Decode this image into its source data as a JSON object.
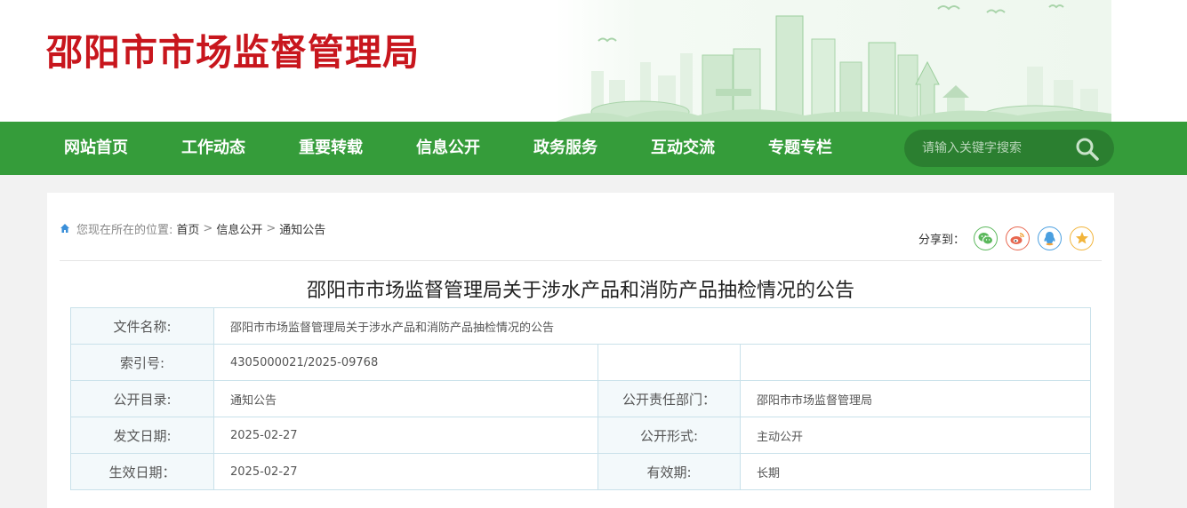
{
  "site": {
    "title": "邵阳市市场监督管理局"
  },
  "nav": {
    "items": [
      "网站首页",
      "工作动态",
      "重要转载",
      "信息公开",
      "政务服务",
      "互动交流",
      "专题专栏"
    ],
    "search_placeholder": "请输入关键字搜索"
  },
  "breadcrumb": {
    "prefix": "您现在所在的位置:",
    "items": [
      "首页",
      "信息公开",
      "通知公告"
    ],
    "separator": ">"
  },
  "share": {
    "label": "分享到：",
    "targets": [
      "wechat",
      "weibo",
      "qq",
      "qzone"
    ]
  },
  "article": {
    "title": "邵阳市市场监督管理局关于涉水产品和消防产品抽检情况的公告"
  },
  "info_table": {
    "file_name_label": "文件名称:",
    "file_name": "邵阳市市场监督管理局关于涉水产品和消防产品抽检情况的公告",
    "index_label": "索引号:",
    "index": "4305000021/2025-09768",
    "catalog_label": "公开目录:",
    "catalog": "通知公告",
    "dept_label": "公开责任部门：",
    "dept": "邵阳市市场监督管理局",
    "date_label": "发文日期:",
    "date": "2025-02-27",
    "form_label": "公开形式:",
    "form": "主动公开",
    "effective_label": "生效日期：",
    "effective": "2025-02-27",
    "validity_label": "有效期:",
    "validity": "长期"
  },
  "colors": {
    "brand_red": "#c8161d",
    "nav_green": "#359c3a",
    "search_green": "#2b7f30",
    "table_border": "#c9e1ea",
    "label_bg": "#f3f9fb"
  }
}
